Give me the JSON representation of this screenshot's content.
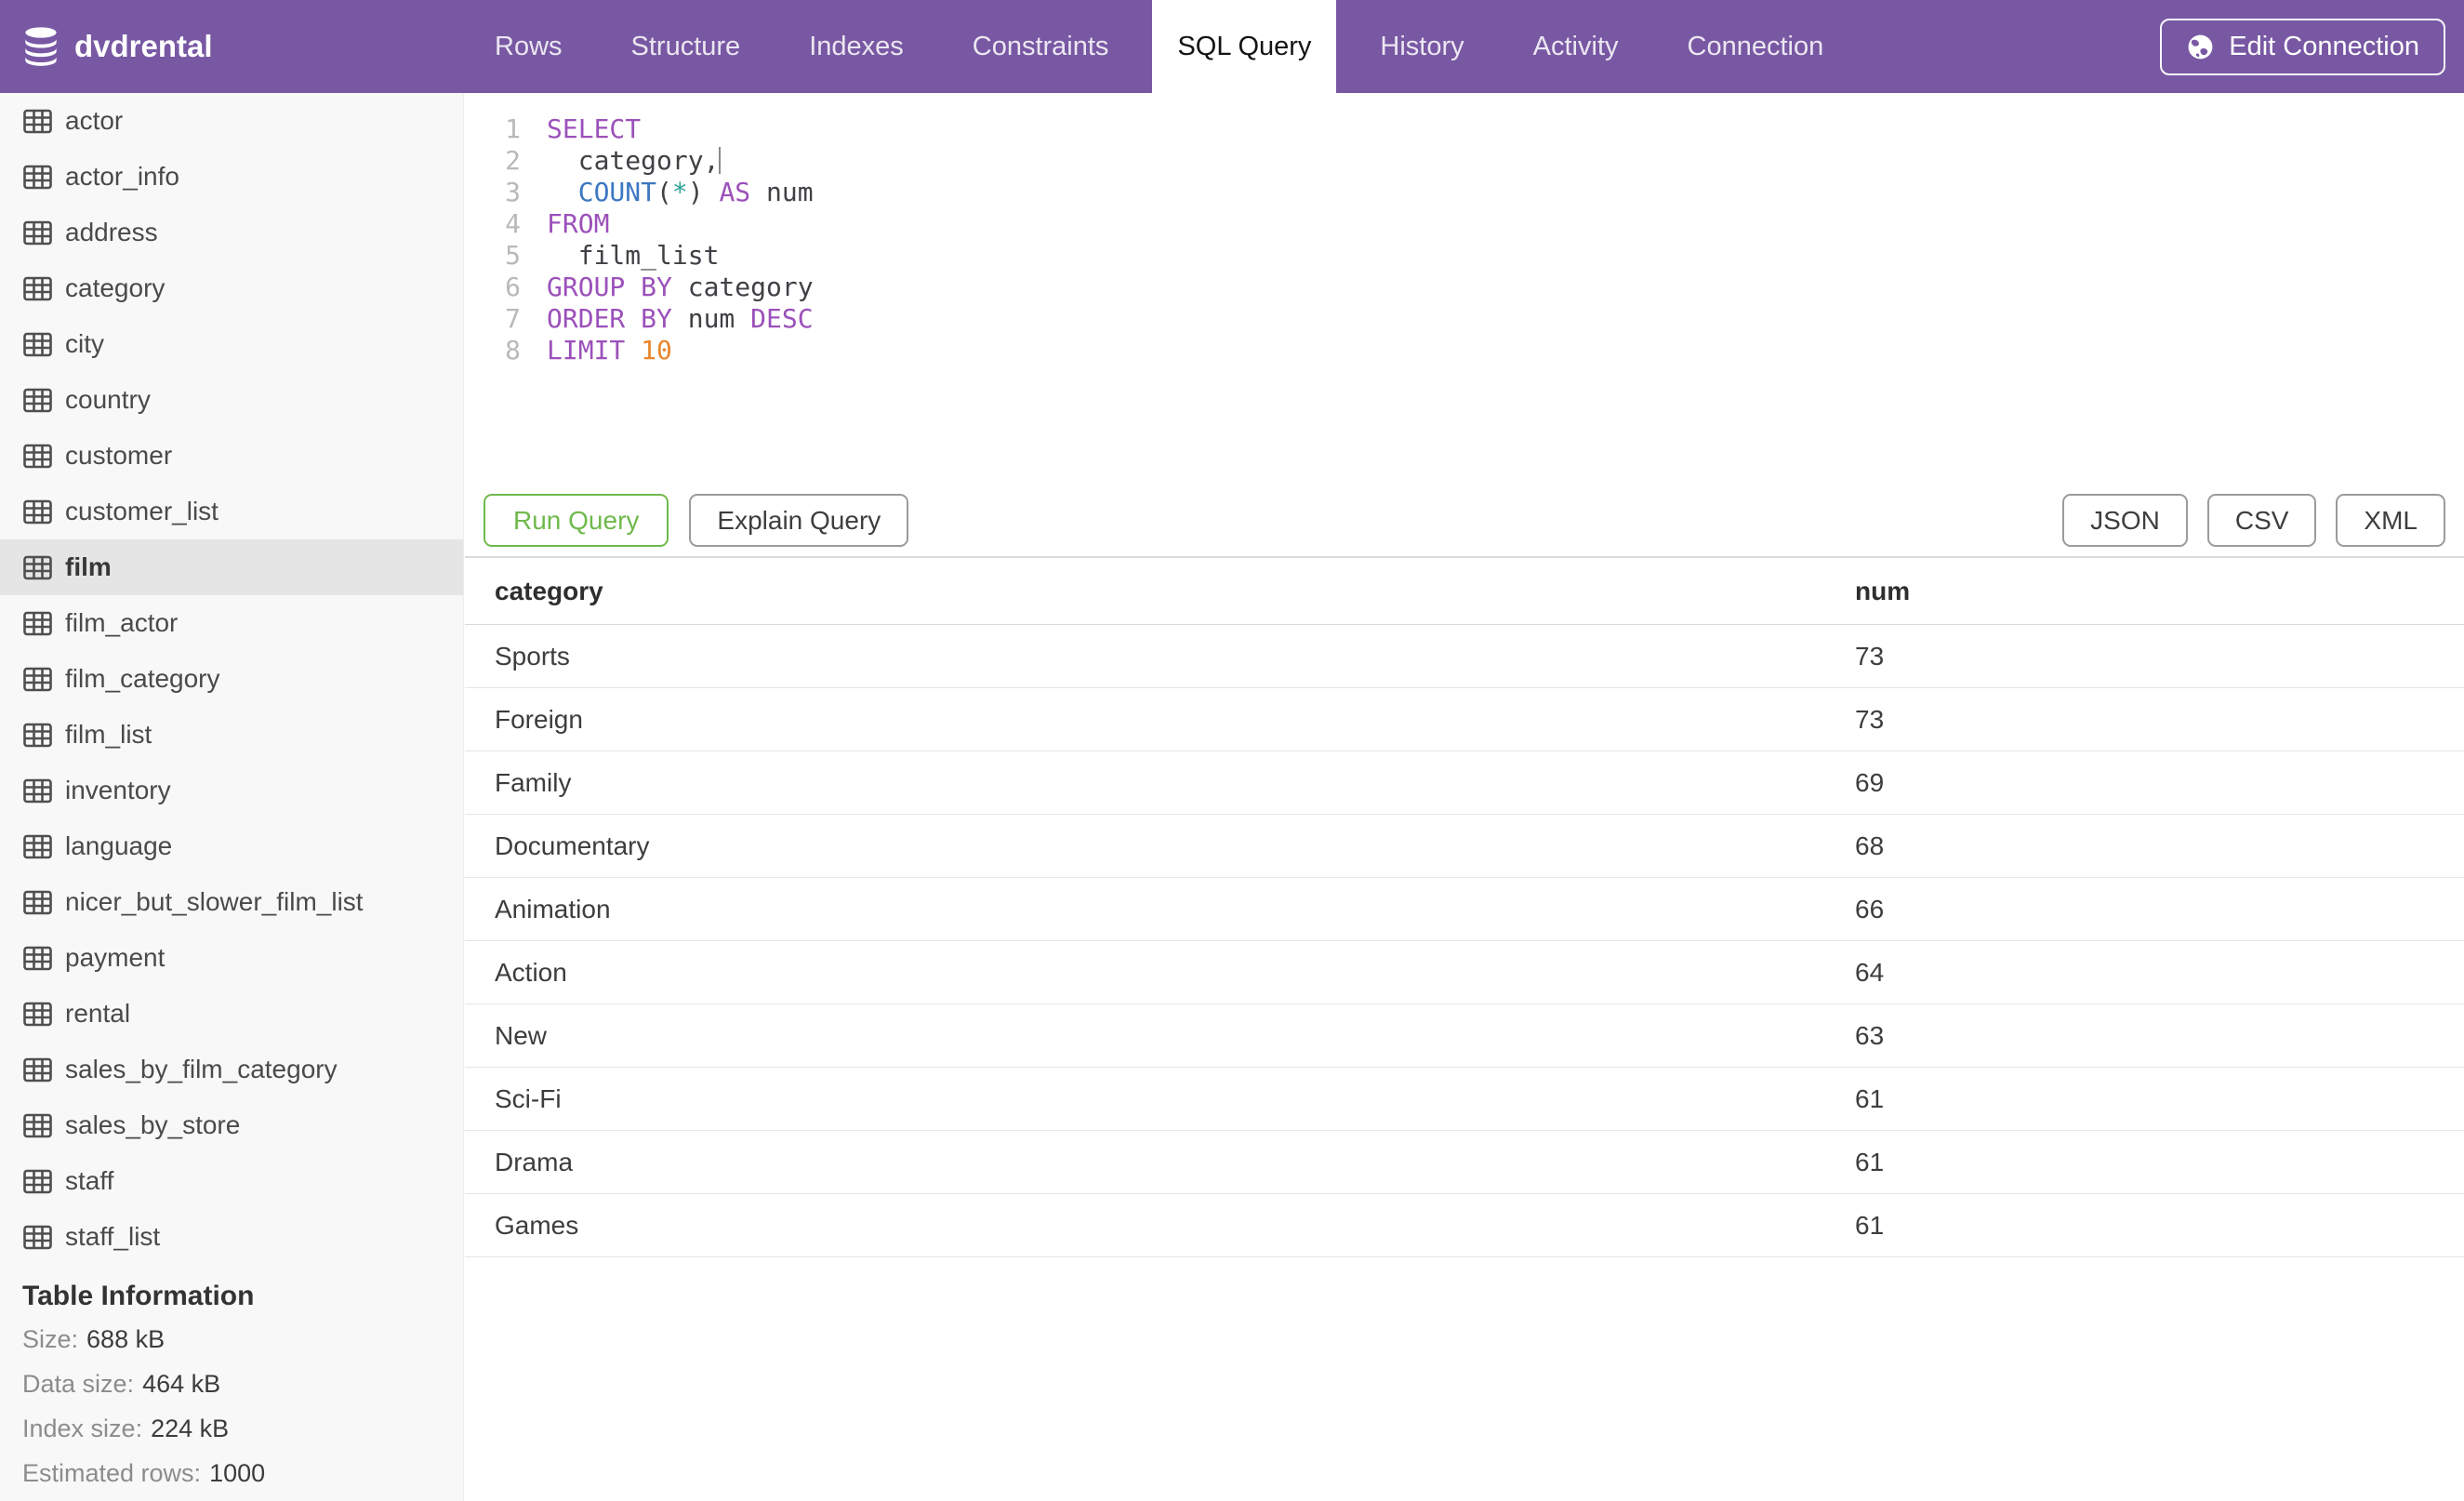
{
  "header": {
    "database": "dvdrental",
    "tabs": [
      {
        "label": "Rows",
        "active": false
      },
      {
        "label": "Structure",
        "active": false
      },
      {
        "label": "Indexes",
        "active": false
      },
      {
        "label": "Constraints",
        "active": false
      },
      {
        "label": "SQL Query",
        "active": true
      },
      {
        "label": "History",
        "active": false
      },
      {
        "label": "Activity",
        "active": false
      },
      {
        "label": "Connection",
        "active": false
      }
    ],
    "edit_connection_label": "Edit Connection"
  },
  "sidebar": {
    "tables": [
      "actor",
      "actor_info",
      "address",
      "category",
      "city",
      "country",
      "customer",
      "customer_list",
      "film",
      "film_actor",
      "film_category",
      "film_list",
      "inventory",
      "language",
      "nicer_but_slower_film_list",
      "payment",
      "rental",
      "sales_by_film_category",
      "sales_by_store",
      "staff",
      "staff_list"
    ],
    "selected_table": "film",
    "table_information": {
      "heading": "Table Information",
      "stats": [
        {
          "label": "Size:",
          "value": "688 kB"
        },
        {
          "label": "Data size:",
          "value": "464 kB"
        },
        {
          "label": "Index size:",
          "value": "224 kB"
        },
        {
          "label": "Estimated rows:",
          "value": "1000"
        }
      ]
    }
  },
  "editor": {
    "lines": [
      [
        [
          "SELECT",
          "kw"
        ]
      ],
      [
        [
          "  category,",
          "plain"
        ],
        [
          "",
          "caret"
        ]
      ],
      [
        [
          "  ",
          "plain"
        ],
        [
          "COUNT",
          "fn"
        ],
        [
          "(",
          "plain"
        ],
        [
          "*",
          "star"
        ],
        [
          ") ",
          "plain"
        ],
        [
          "AS",
          "kw"
        ],
        [
          " num",
          "plain"
        ]
      ],
      [
        [
          "FROM",
          "kw"
        ]
      ],
      [
        [
          "  film_list",
          "plain"
        ]
      ],
      [
        [
          "GROUP BY",
          "kw"
        ],
        [
          " category",
          "plain"
        ]
      ],
      [
        [
          "ORDER BY",
          "kw"
        ],
        [
          " num ",
          "plain"
        ],
        [
          "DESC",
          "kw"
        ]
      ],
      [
        [
          "LIMIT",
          "kw"
        ],
        [
          " ",
          "plain"
        ],
        [
          "10",
          "num"
        ]
      ]
    ]
  },
  "toolbar": {
    "run_label": "Run Query",
    "explain_label": "Explain Query",
    "export_buttons": [
      "JSON",
      "CSV",
      "XML"
    ]
  },
  "results": {
    "columns": [
      "category",
      "num"
    ],
    "rows": [
      [
        "Sports",
        73
      ],
      [
        "Foreign",
        73
      ],
      [
        "Family",
        69
      ],
      [
        "Documentary",
        68
      ],
      [
        "Animation",
        66
      ],
      [
        "Action",
        64
      ],
      [
        "New",
        63
      ],
      [
        "Sci-Fi",
        61
      ],
      [
        "Drama",
        61
      ],
      [
        "Games",
        61
      ]
    ]
  },
  "colors": {
    "header_purple": "#7858a3",
    "accent_green": "#6fb94c",
    "sql_keyword": "#9b50ba",
    "sql_function": "#3d77c2",
    "sql_star": "#2aa198",
    "sql_number": "#e8862b",
    "sidebar_bg": "#f8f8f8",
    "selected_row_bg": "#e5e5e5"
  }
}
